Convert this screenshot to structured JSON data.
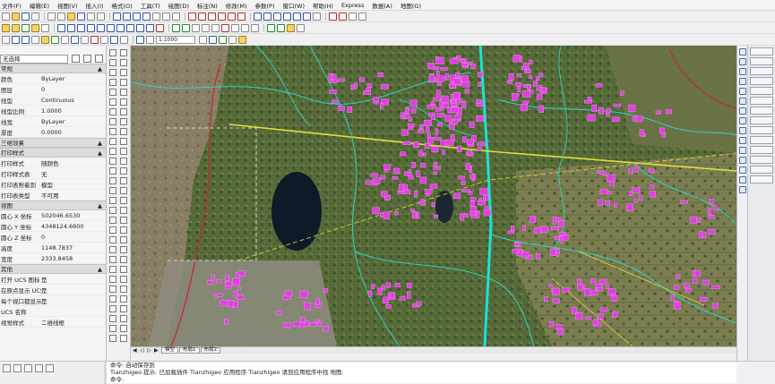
{
  "menu": {
    "items": [
      "文件(F)",
      "编辑(E)",
      "视图(V)",
      "插入(I)",
      "格式(O)",
      "工具(T)",
      "绘图(D)",
      "标注(N)",
      "修改(M)",
      "参数(P)",
      "窗口(W)",
      "帮助(H)",
      "Express",
      "数据(A)",
      "地图(G)"
    ]
  },
  "toolbar": {
    "scale_value": "1:1000"
  },
  "properties": {
    "selection": "无选择",
    "sections": [
      {
        "title": "常规",
        "rows": [
          {
            "k": "颜色",
            "v": "ByLayer"
          },
          {
            "k": "图层",
            "v": "0"
          },
          {
            "k": "线型",
            "v": "Continuous"
          },
          {
            "k": "线型比例",
            "v": "1.0000"
          },
          {
            "k": "线宽",
            "v": "ByLayer"
          },
          {
            "k": "厚度",
            "v": "0.0000"
          }
        ]
      },
      {
        "title": "三维效果",
        "rows": []
      },
      {
        "title": "打印样式",
        "rows": [
          {
            "k": "打印样式",
            "v": "随颜色"
          },
          {
            "k": "打印样式表",
            "v": "无"
          },
          {
            "k": "打印表附着到",
            "v": "模型"
          },
          {
            "k": "打印表类型",
            "v": "不可用"
          }
        ]
      },
      {
        "title": "视图",
        "rows": [
          {
            "k": "圆心 X 坐标",
            "v": "502046.6530"
          },
          {
            "k": "圆心 Y 坐标",
            "v": "4348124.6600"
          },
          {
            "k": "圆心 Z 坐标",
            "v": "0"
          },
          {
            "k": "高度",
            "v": "1148.7837"
          },
          {
            "k": "宽度",
            "v": "2333.8458"
          }
        ]
      },
      {
        "title": "其他",
        "rows": [
          {
            "k": "打开 UCS 图标",
            "v": "是"
          },
          {
            "k": "在原点显示 UCS",
            "v": "是"
          },
          {
            "k": "每个视口都显示",
            "v": "是"
          },
          {
            "k": "UCS 名称",
            "v": ""
          },
          {
            "k": "视觉样式",
            "v": "二维线框"
          }
        ]
      }
    ]
  },
  "layout_tabs": [
    "模型",
    "布局1",
    "布局2"
  ],
  "command": {
    "line1": "命令: 自动保存到",
    "line2": "Tianzhigeo 提示: 已加载插件 Tianzhigeo 应用程序 Tianzhigeo 请到应用程序中找 地图.",
    "prompt": "命令:"
  },
  "colors": {
    "accent": "#3355aa",
    "road": "#2fd3c7",
    "building": "#e040e0",
    "highway": "#e8e040",
    "water": "#0e1a28"
  }
}
